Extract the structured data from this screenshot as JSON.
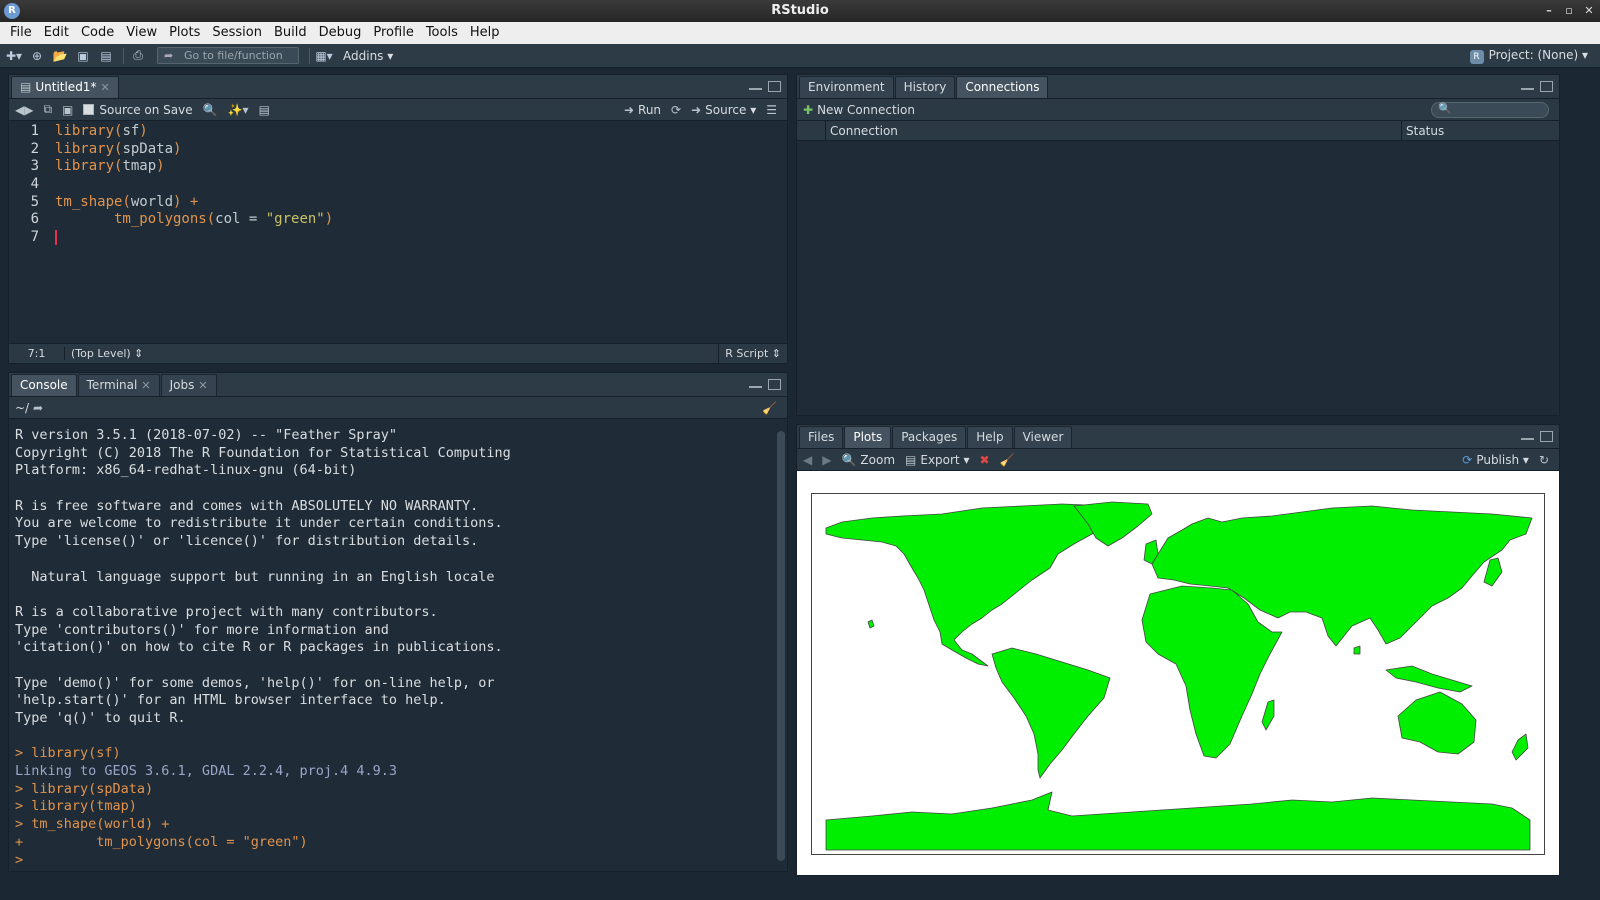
{
  "window": {
    "title": "RStudio"
  },
  "menu": [
    "File",
    "Edit",
    "Code",
    "View",
    "Plots",
    "Session",
    "Build",
    "Debug",
    "Profile",
    "Tools",
    "Help"
  ],
  "toolbar": {
    "goto_placeholder": "Go to file/function",
    "addins_label": "Addins",
    "project_label": "Project: (None)"
  },
  "editor": {
    "tab_label": "Untitled1*",
    "source_on_save": "Source on Save",
    "run_label": "Run",
    "source_label": "Source",
    "lines": [
      {
        "n": "1",
        "fn": "library(",
        "arg": "sf",
        "close": ")",
        "str": ""
      },
      {
        "n": "2",
        "fn": "library(",
        "arg": "spData",
        "close": ")",
        "str": ""
      },
      {
        "n": "3",
        "fn": "library(",
        "arg": "tmap",
        "close": ")",
        "str": ""
      },
      {
        "n": "4",
        "fn": "",
        "arg": "",
        "close": "",
        "str": ""
      },
      {
        "n": "5",
        "fn": "tm_shape(",
        "arg": "world",
        "close": ") +",
        "str": ""
      },
      {
        "n": "6",
        "fn": "       tm_polygons(",
        "arg": "col = ",
        "close": ")",
        "str": "\"green\""
      },
      {
        "n": "7",
        "fn": "",
        "arg": "",
        "close": "",
        "str": ""
      }
    ],
    "status": {
      "position": "7:1",
      "scope": "(Top Level)",
      "filetype": "R Script"
    }
  },
  "console": {
    "tabs": [
      "Console",
      "Terminal",
      "Jobs"
    ],
    "path": "~/",
    "lines": [
      {
        "t": "R version 3.5.1 (2018-07-02) -- \"Feather Spray\"",
        "k": "out"
      },
      {
        "t": "Copyright (C) 2018 The R Foundation for Statistical Computing",
        "k": "out"
      },
      {
        "t": "Platform: x86_64-redhat-linux-gnu (64-bit)",
        "k": "out"
      },
      {
        "t": "",
        "k": "out"
      },
      {
        "t": "R is free software and comes with ABSOLUTELY NO WARRANTY.",
        "k": "out"
      },
      {
        "t": "You are welcome to redistribute it under certain conditions.",
        "k": "out"
      },
      {
        "t": "Type 'license()' or 'licence()' for distribution details.",
        "k": "out"
      },
      {
        "t": "",
        "k": "out"
      },
      {
        "t": "  Natural language support but running in an English locale",
        "k": "out"
      },
      {
        "t": "",
        "k": "out"
      },
      {
        "t": "R is a collaborative project with many contributors.",
        "k": "out"
      },
      {
        "t": "Type 'contributors()' for more information and",
        "k": "out"
      },
      {
        "t": "'citation()' on how to cite R or R packages in publications.",
        "k": "out"
      },
      {
        "t": "",
        "k": "out"
      },
      {
        "t": "Type 'demo()' for some demos, 'help()' for on-line help, or",
        "k": "out"
      },
      {
        "t": "'help.start()' for an HTML browser interface to help.",
        "k": "out"
      },
      {
        "t": "Type 'q()' to quit R.",
        "k": "out"
      },
      {
        "t": "",
        "k": "out"
      },
      {
        "t": "> library(sf)",
        "k": "cmd"
      },
      {
        "t": "Linking to GEOS 3.6.1, GDAL 2.2.4, proj.4 4.9.3",
        "k": "msg"
      },
      {
        "t": "> library(spData)",
        "k": "cmd"
      },
      {
        "t": "> library(tmap)",
        "k": "cmd"
      },
      {
        "t": "> tm_shape(world) +",
        "k": "cmd"
      },
      {
        "t": "+         tm_polygons(col = \"green\")",
        "k": "cmd"
      },
      {
        "t": "> ",
        "k": "cmd"
      }
    ]
  },
  "env": {
    "tabs": [
      "Environment",
      "History",
      "Connections"
    ],
    "new_connection": "New Connection",
    "columns": [
      "Connection",
      "Status"
    ]
  },
  "files": {
    "tabs": [
      "Files",
      "Plots",
      "Packages",
      "Help",
      "Viewer"
    ],
    "zoom_label": "Zoom",
    "export_label": "Export",
    "publish_label": "Publish"
  },
  "colors": {
    "map_fill": "#00ee00",
    "map_stroke": "#444444",
    "accent_orange": "#e0934c"
  }
}
